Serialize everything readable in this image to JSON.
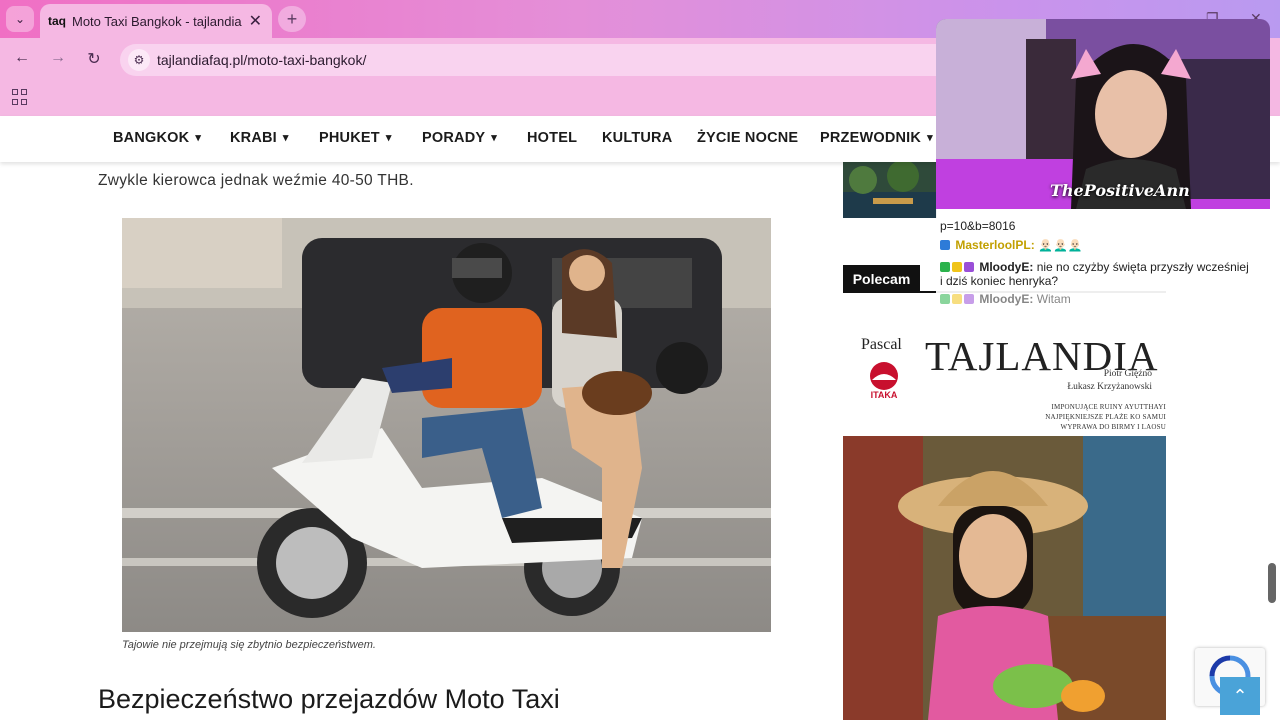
{
  "browser": {
    "tab_title": "Moto Taxi Bangkok - tajlandiaF",
    "tab_favicon": "taq",
    "url": "tajlandiafaq.pl/moto-taxi-bangkok/"
  },
  "nav": {
    "items": [
      {
        "label": "BANGKOK",
        "caret": true
      },
      {
        "label": "KRABI",
        "caret": true
      },
      {
        "label": "PHUKET",
        "caret": true
      },
      {
        "label": "PORADY",
        "caret": true
      },
      {
        "label": "HOTEL",
        "caret": false
      },
      {
        "label": "KULTURA",
        "caret": false
      },
      {
        "label": "ŻYCIE NOCNE",
        "caret": false
      },
      {
        "label": "PRZEWODNIK",
        "caret": true
      }
    ]
  },
  "article": {
    "text_line": "Zwykle kierowca jednak weźmie 40-50 THB.",
    "caption": "Tajowie nie przejmują się zbytnio bezpieczeństwem.",
    "heading": "Bezpieczeństwo przejazdów Moto Taxi"
  },
  "sidebar": {
    "section_title": "Polecam",
    "book": {
      "publisher": "Pascal",
      "imprint": "ITAKA",
      "title": "TAJLANDIA",
      "authors": [
        "Piotr Gięźno",
        "Łukasz Krzyżanowski"
      ],
      "highlights": [
        "IMPONUJĄCE RUINY AYUTTHAYI",
        "NAJPIĘKNIEJSZE PLAŻE KO SAMUI",
        "WYPRAWA DO BIRMY I LAOSU"
      ]
    }
  },
  "stream": {
    "streamer": "ThePositiveAnn",
    "chat": [
      {
        "user": "",
        "text": "p=10&b=8016"
      },
      {
        "user": "MasterloolPL:",
        "text": "👨🏻‍🦲👨🏻‍🦲👨🏻‍🦲"
      },
      {
        "user": "MloodyE:",
        "text": "nie no czyżby święta przyszły wcześniej"
      },
      {
        "user": "",
        "text": "i dziś koniec henryka?"
      },
      {
        "user": "MloodyE:",
        "text": "Witam"
      }
    ]
  },
  "colors": {
    "chrome_pink": "#f5b8e3",
    "accent_blue": "#4aa3d8",
    "cam_purple": "#b44fe0"
  }
}
